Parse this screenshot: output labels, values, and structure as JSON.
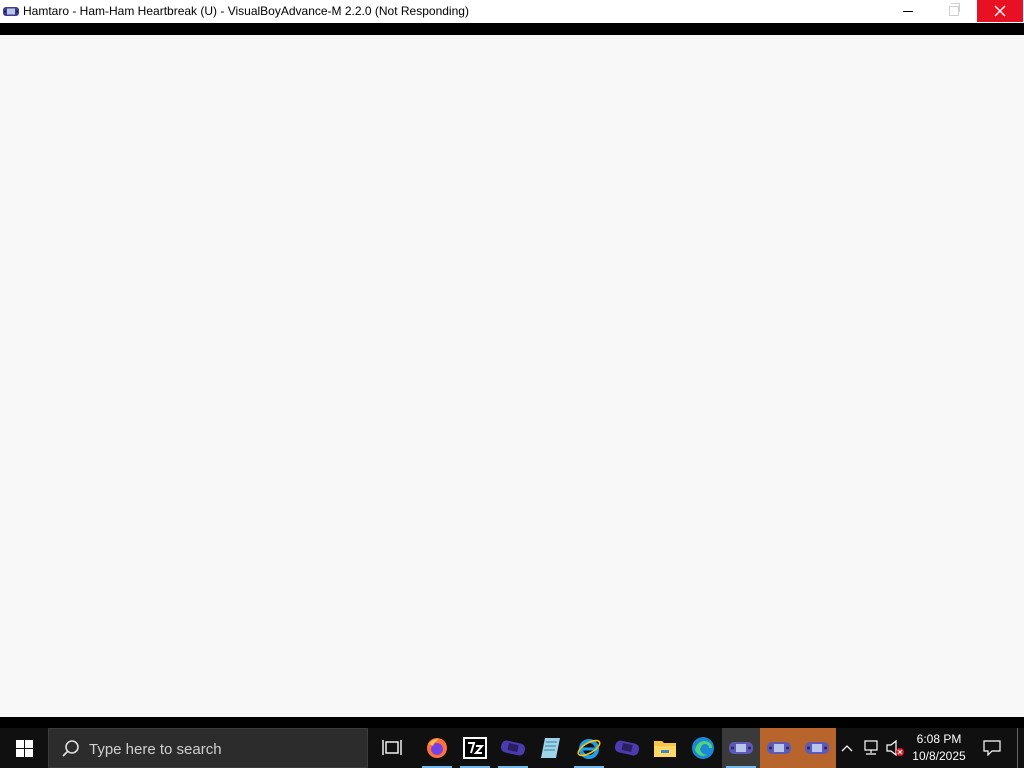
{
  "window": {
    "title": "Hamtaro - Ham-Ham Heartbreak (U) - VisualBoyAdvance-M 2.2.0 (Not Responding)",
    "content_color": "#f8f8f8"
  },
  "taskbar": {
    "search_placeholder": "Type here to search",
    "pinned": [
      {
        "name": "task-view-icon"
      },
      {
        "name": "firefox-icon"
      },
      {
        "name": "7zip-icon"
      },
      {
        "name": "gba-emulator-icon"
      },
      {
        "name": "notepad-icon"
      },
      {
        "name": "internet-explorer-icon"
      },
      {
        "name": "gba-emulator-icon"
      },
      {
        "name": "file-explorer-icon"
      },
      {
        "name": "edge-icon"
      },
      {
        "name": "visualboyadvance-icon"
      },
      {
        "name": "visualboyadvance-icon"
      },
      {
        "name": "visualboyadvance-icon"
      }
    ],
    "clock_time": "6:08 PM",
    "clock_date": "10/8/2025",
    "accent": "#76b9ed",
    "highlight": "#b7652c"
  }
}
